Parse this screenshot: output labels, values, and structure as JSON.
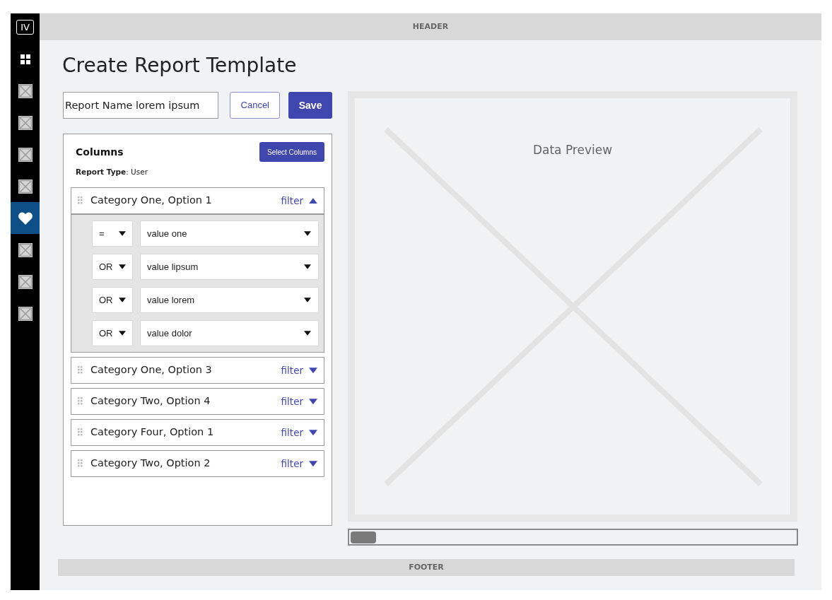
{
  "sidebar": {
    "logo": "IV",
    "items": [
      {
        "kind": "grid",
        "selected": false
      },
      {
        "kind": "placeholder",
        "selected": false
      },
      {
        "kind": "placeholder",
        "selected": false
      },
      {
        "kind": "placeholder",
        "selected": false
      },
      {
        "kind": "placeholder",
        "selected": false
      },
      {
        "kind": "heart",
        "selected": true
      },
      {
        "kind": "placeholder",
        "selected": false
      },
      {
        "kind": "placeholder",
        "selected": false
      },
      {
        "kind": "placeholder",
        "selected": false
      }
    ]
  },
  "header": "HEADER",
  "title": "Create Report Template",
  "report_name": {
    "value": "Report Name lorem ipsum"
  },
  "buttons": {
    "cancel": "Cancel",
    "save": "Save"
  },
  "columns_panel": {
    "title": "Columns",
    "select_button": "Select Columns",
    "report_type_label": "Report Type",
    "report_type_value": ": User",
    "rows": [
      {
        "label": "Category One, Option 1",
        "filter": "filter",
        "expanded": true,
        "conditions": [
          {
            "operator": "=",
            "value": "value one"
          },
          {
            "operator": "OR",
            "value": "value lipsum"
          },
          {
            "operator": "OR",
            "value": "value lorem"
          },
          {
            "operator": "OR",
            "value": "value dolor"
          }
        ]
      },
      {
        "label": "Category One, Option 3",
        "filter": "filter",
        "expanded": false
      },
      {
        "label": "Category Two, Option 4",
        "filter": "filter",
        "expanded": false
      },
      {
        "label": "Category Four, Option 1",
        "filter": "filter",
        "expanded": false
      },
      {
        "label": "Category Two, Option 2",
        "filter": "filter",
        "expanded": false
      }
    ]
  },
  "preview": {
    "label": "Data Preview"
  },
  "footer": "FOOTER"
}
